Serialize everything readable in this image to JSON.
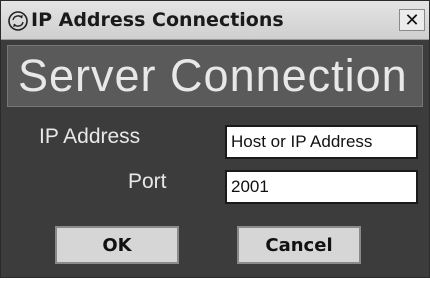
{
  "window": {
    "title": "IP Address Connections",
    "close_glyph": "✕",
    "icon": "network-connection-icon"
  },
  "header": {
    "title": "Server Connection"
  },
  "form": {
    "ip_label": "IP Address",
    "ip_value": "Host or IP Address",
    "port_label": "Port",
    "port_value": "2001"
  },
  "buttons": {
    "ok_label": "OK",
    "cancel_label": "Cancel"
  },
  "colors": {
    "window_bg": "#3c3c3c",
    "header_bg": "#5a5a5a",
    "titlebar_bg": "#d9d9d9",
    "text_light": "#e8e8e8"
  }
}
